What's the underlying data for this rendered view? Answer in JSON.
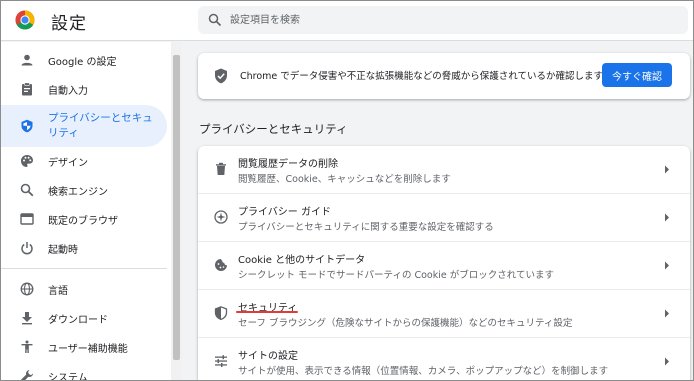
{
  "header": {
    "title": "設定",
    "search_placeholder": "設定項目を検索"
  },
  "sidebar": {
    "items": [
      {
        "label": "Google の設定",
        "icon": "person-icon"
      },
      {
        "label": "自動入力",
        "icon": "clipboard-icon"
      },
      {
        "label": "プライバシーとセキュリティ",
        "icon": "shield-icon",
        "active": true
      },
      {
        "label": "デザイン",
        "icon": "palette-icon"
      },
      {
        "label": "検索エンジン",
        "icon": "search-icon"
      },
      {
        "label": "既定のブラウザ",
        "icon": "browser-icon"
      },
      {
        "label": "起動時",
        "icon": "power-icon"
      },
      {
        "label": "言語",
        "icon": "globe-icon"
      },
      {
        "label": "ダウンロード",
        "icon": "download-icon"
      },
      {
        "label": "ユーザー補助機能",
        "icon": "accessibility-icon"
      },
      {
        "label": "システム",
        "icon": "wrench-icon"
      }
    ]
  },
  "safety_check": {
    "text": "Chrome でデータ侵害や不正な拡張機能などの脅威から保護されているか確認します",
    "button": "今すぐ確認"
  },
  "section": {
    "title": "プライバシーとセキュリティ",
    "rows": [
      {
        "title": "閲覧履歴データの削除",
        "subtitle": "閲覧履歴、Cookie、キャッシュなどを削除します",
        "icon": "trash-icon"
      },
      {
        "title": "プライバシー ガイド",
        "subtitle": "プライバシーとセキュリティに関する重要な設定を確認する",
        "icon": "compass-icon"
      },
      {
        "title": "Cookie と他のサイトデータ",
        "subtitle": "シークレット モードでサードパーティの Cookie がブロックされています",
        "icon": "cookie-icon"
      },
      {
        "title": "セキュリティ",
        "subtitle": "セーフ ブラウジング（危険なサイトからの保護機能）などのセキュリティ設定",
        "icon": "shield-half-icon"
      },
      {
        "title": "サイトの設定",
        "subtitle": "サイトが使用、表示できる情報（位置情報、カメラ、ポップアップなど）を制御します",
        "icon": "sliders-icon"
      }
    ]
  },
  "colors": {
    "accent": "#1a73e8",
    "active_bg": "#e8f0fe",
    "annotation_underline": "#e53935"
  }
}
